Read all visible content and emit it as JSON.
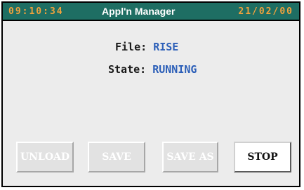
{
  "header": {
    "time": "09:10:34",
    "title": "Appl'n Manager",
    "date": "21/02/00"
  },
  "info": {
    "file_label": "File:",
    "file_value": "RISE",
    "state_label": "State:",
    "state_value": "RUNNING"
  },
  "buttons": [
    {
      "label": "UNLOAD",
      "enabled": false
    },
    {
      "label": "SAVE",
      "enabled": false
    },
    {
      "label": "SAVE AS",
      "enabled": false
    },
    {
      "label": "STOP",
      "enabled": true
    }
  ],
  "colors": {
    "titlebar": "#1e6e63",
    "clock_text": "#f2a23c",
    "value_text": "#2c5fb8",
    "panel_bg": "#ececec"
  }
}
